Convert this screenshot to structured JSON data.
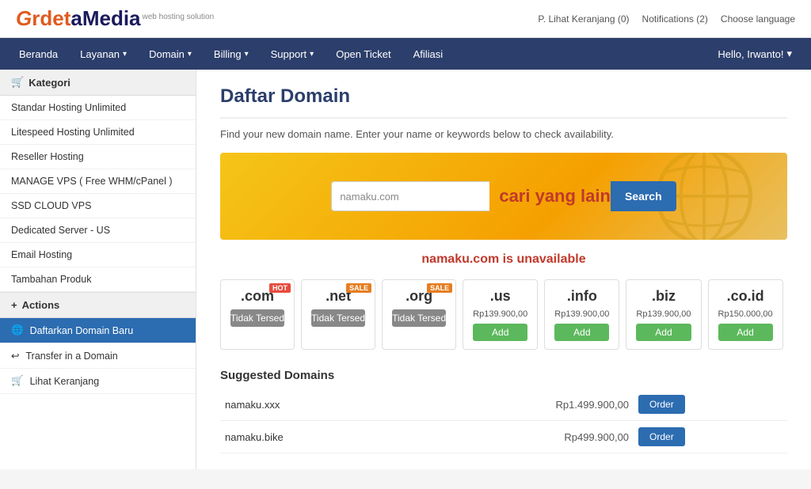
{
  "topbar": {
    "logo_ardet": "Grdet",
    "logo_a": "a",
    "logo_media": "Media",
    "logo_sub": "web hosting solution",
    "top_links": [
      "P. Lihat Keranjang (0)",
      "Notifications (2)",
      "Choose language"
    ]
  },
  "nav": {
    "items": [
      {
        "label": "Beranda",
        "has_dropdown": false
      },
      {
        "label": "Layanan",
        "has_dropdown": true
      },
      {
        "label": "Domain",
        "has_dropdown": true
      },
      {
        "label": "Billing",
        "has_dropdown": true
      },
      {
        "label": "Support",
        "has_dropdown": true
      },
      {
        "label": "Open Ticket",
        "has_dropdown": false
      },
      {
        "label": "Afiliasi",
        "has_dropdown": false
      }
    ],
    "user_label": "Hello, Irwanto!",
    "user_dropdown": true
  },
  "sidebar": {
    "kategori_title": "Kategori",
    "kategori_icon": "🛒",
    "kategori_items": [
      "Standar Hosting Unlimited",
      "Litespeed Hosting Unlimited",
      "Reseller Hosting",
      "MANAGE VPS ( Free WHM/cPanel )",
      "SSD CLOUD VPS",
      "Dedicated Server - US",
      "Email Hosting",
      "Tambahan Produk"
    ],
    "actions_title": "Actions",
    "actions_icon": "+",
    "actions_items": [
      {
        "label": "Daftarkan Domain Baru",
        "icon": "🌐",
        "active": true
      },
      {
        "label": "Transfer in a Domain",
        "icon": "↩",
        "active": false
      },
      {
        "label": "Lihat Keranjang",
        "icon": "🛒",
        "active": false
      }
    ]
  },
  "content": {
    "title": "Daftar Domain",
    "description": "Find your new domain name. Enter your name or keywords below to check availability.",
    "search_value": "namaku.com",
    "search_tagline": "cari yang lain",
    "search_button": "Search",
    "unavailable_text": "namaku.com is unavailable",
    "tlds": [
      {
        "name": ".com",
        "price": "",
        "status": "unavail",
        "btn_label": "Tidak Tersed",
        "badge": "HOT"
      },
      {
        "name": ".net",
        "price": "",
        "status": "unavail",
        "btn_label": "Tidak Tersed",
        "badge": "SALE"
      },
      {
        "name": ".org",
        "price": "",
        "status": "unavail",
        "btn_label": "Tidak Tersed",
        "badge": "SALE"
      },
      {
        "name": ".us",
        "price": "Rp139.900,00",
        "status": "add",
        "btn_label": "Add",
        "badge": ""
      },
      {
        "name": ".info",
        "price": "Rp139.900,00",
        "status": "add",
        "btn_label": "Add",
        "badge": ""
      },
      {
        "name": ".biz",
        "price": "Rp139.900,00",
        "status": "add",
        "btn_label": "Add",
        "badge": ""
      },
      {
        "name": ".co.id",
        "price": "Rp150.000,00",
        "status": "add",
        "btn_label": "Add",
        "badge": ""
      }
    ],
    "suggested_title": "Suggested Domains",
    "suggested_domains": [
      {
        "name": "namaku.xxx",
        "price": "Rp1.499.900,00",
        "btn": "Order"
      },
      {
        "name": "namaku.bike",
        "price": "Rp499.900,00",
        "btn": "Order"
      }
    ]
  }
}
